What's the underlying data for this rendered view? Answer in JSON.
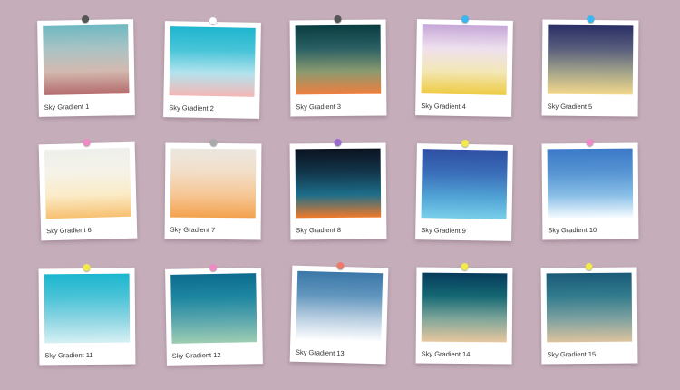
{
  "cards": [
    {
      "label": "Sky Gradient 1",
      "pin": "#555555",
      "stops": [
        "#6fb9c2",
        "#a9c3c4",
        "#d3b9b0",
        "#b46b6c"
      ]
    },
    {
      "label": "Sky Gradient 2",
      "pin": "#ffffff",
      "stops": [
        "#1fb6cf",
        "#48c4d8",
        "#b3e3ee",
        "#f4b7b5"
      ]
    },
    {
      "label": "Sky Gradient 3",
      "pin": "#555555",
      "stops": [
        "#0a3d40",
        "#2a6063",
        "#8a9a70",
        "#f07e3e"
      ]
    },
    {
      "label": "Sky Gradient 4",
      "pin": "#3ab6f0",
      "stops": [
        "#c6a8d8",
        "#eee0ee",
        "#f3e7b6",
        "#eecb42"
      ]
    },
    {
      "label": "Sky Gradient 5",
      "pin": "#3ab6f0",
      "stops": [
        "#2a2f65",
        "#575d7c",
        "#a1a28a",
        "#f3d88c"
      ]
    },
    {
      "label": "Sky Gradient 6",
      "pin": "#f08ac6",
      "stops": [
        "#eef0ec",
        "#f5f2e8",
        "#fbecc8",
        "#f7c070"
      ]
    },
    {
      "label": "Sky Gradient 7",
      "pin": "#aaaaaa",
      "stops": [
        "#ebe7e0",
        "#f2dec8",
        "#f6c796",
        "#f3a24d"
      ]
    },
    {
      "label": "Sky Gradient 8",
      "pin": "#9a6ad0",
      "stops": [
        "#0b1220",
        "#12354a",
        "#1d6e8a",
        "#f07a2a"
      ]
    },
    {
      "label": "Sky Gradient 9",
      "pin": "#f2e94b",
      "stops": [
        "#2e4fa3",
        "#3a6db8",
        "#4fa0d4",
        "#79cfe9"
      ]
    },
    {
      "label": "Sky Gradient 10",
      "pin": "#f08ac6",
      "stops": [
        "#3c79c7",
        "#5593d2",
        "#87bde6",
        "#f4fbff"
      ]
    },
    {
      "label": "Sky Gradient 11",
      "pin": "#f2e94b",
      "stops": [
        "#1bb6cf",
        "#4ac3d7",
        "#8fd6e3",
        "#d6f0f4"
      ]
    },
    {
      "label": "Sky Gradient 12",
      "pin": "#f08ac6",
      "stops": [
        "#0d6b8f",
        "#1c86a0",
        "#5aa6ad",
        "#9ecdb2"
      ]
    },
    {
      "label": "Sky Gradient 13",
      "pin": "#f07a6a",
      "stops": [
        "#3a77a8",
        "#6095bd",
        "#b7cde0",
        "#ffffff"
      ]
    },
    {
      "label": "Sky Gradient 14",
      "pin": "#f2e94b",
      "stops": [
        "#073a5a",
        "#136873",
        "#80a69a",
        "#e8c79e"
      ]
    },
    {
      "label": "Sky Gradient 15",
      "pin": "#f2e94b",
      "stops": [
        "#1b5a78",
        "#327b8d",
        "#7ea1a0",
        "#ddc39e"
      ]
    }
  ]
}
